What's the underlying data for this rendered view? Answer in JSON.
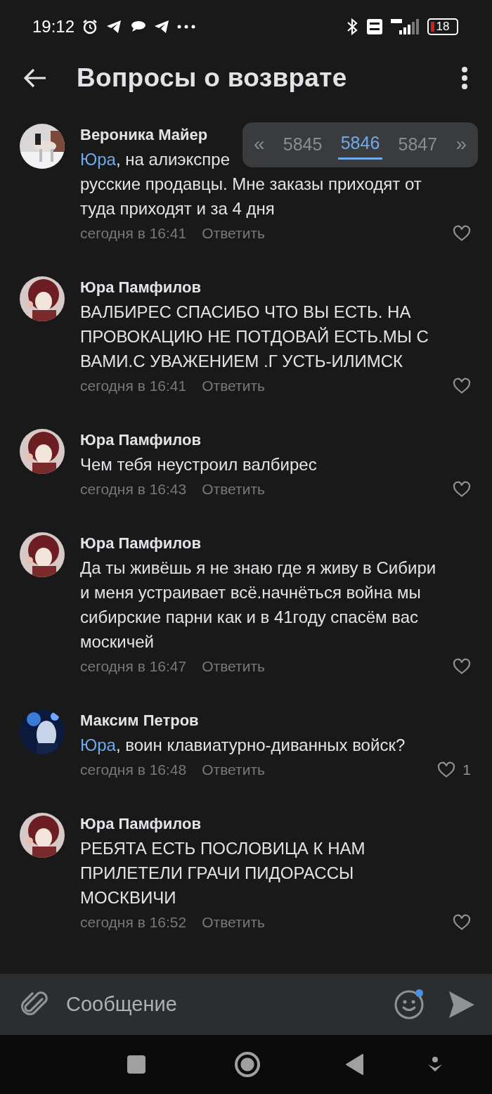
{
  "status_bar": {
    "time": "19:12",
    "battery": "18"
  },
  "header": {
    "title": "Вопросы о возврате"
  },
  "pager": {
    "prev": "«",
    "next": "»",
    "pages": [
      {
        "label": "5845",
        "selected": false
      },
      {
        "label": "5846",
        "selected": true
      },
      {
        "label": "5847",
        "selected": false
      }
    ]
  },
  "comments": [
    {
      "author": "Вероника Майер",
      "mention": "Юра",
      "text": ", на алиэкспре",
      "text_lines": [
        "русские продавцы. Мне заказы приходят от",
        "туда приходят и за 4 дня"
      ],
      "time": "сегодня в 16:41",
      "reply": "Ответить"
    },
    {
      "author": "Юра Памфилов",
      "text": "ВАЛБИРЕС СПАСИБО ЧТО ВЫ ЕСТЬ. НА ПРОВОКАЦИЮ НЕ ПОТДОВАЙ ЕСТЬ.МЫ С ВАМИ.С УВАЖЕНИЕМ .Г УСТЬ-ИЛИМСК",
      "time": "сегодня в 16:41",
      "reply": "Ответить"
    },
    {
      "author": "Юра Памфилов",
      "text": "Чем тебя неустроил валбирес",
      "time": "сегодня в 16:43",
      "reply": "Ответить"
    },
    {
      "author": "Юра Памфилов",
      "text": "Да ты живёшь  я не знаю где я живу в Сибири и меня устраивает всё.начнёться война мы сибирские парни как и в 41году спасём вас москичей",
      "time": "сегодня в 16:47",
      "reply": "Ответить"
    },
    {
      "author": "Максим Петров",
      "mention": "Юра",
      "text": ", воин клавиатурно-диванных войск?",
      "time": "сегодня в 16:48",
      "reply": "Ответить",
      "likes": "1"
    },
    {
      "author": "Юра Памфилов",
      "text": "РЕБЯТА ЕСТЬ ПОСЛОВИЦА К НАМ ПРИЛЕТЕЛИ ГРАЧИ ПИДОРАССЫ МОСКВИЧИ",
      "time": "сегодня в 16:52",
      "reply": "Ответить"
    }
  ],
  "composer": {
    "placeholder": "Сообщение",
    "emoji_badge": true
  }
}
